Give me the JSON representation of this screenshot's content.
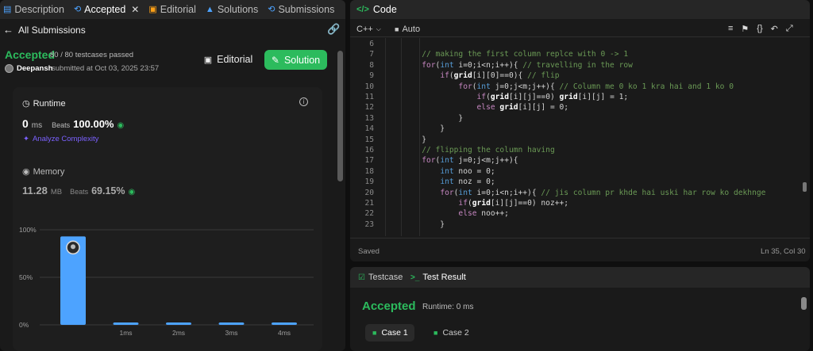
{
  "tabs": [
    {
      "label": "Description",
      "icon": "document-icon",
      "color": "#4da3ff"
    },
    {
      "label": "Accepted",
      "icon": "history-icon",
      "color": "#4da3ff"
    },
    {
      "label": "Editorial",
      "icon": "book-icon",
      "color": "#ffa116"
    },
    {
      "label": "Solutions",
      "icon": "flask-icon",
      "color": "#4da3ff"
    },
    {
      "label": "Submissions",
      "icon": "history-icon",
      "color": "#4da3ff"
    }
  ],
  "back_label": "All Submissions",
  "submission": {
    "status": "Accepted",
    "testcases": "80 / 80 testcases passed",
    "user": "Deepansh",
    "submitted": "submitted at Oct 03, 2025 23:57",
    "editorial_label": "Editorial",
    "solution_label": "Solution"
  },
  "runtime": {
    "title": "Runtime",
    "value": "0",
    "unit": "ms",
    "beats_label": "Beats",
    "beats_value": "100.00%",
    "analyze": "Analyze Complexity"
  },
  "memory": {
    "title": "Memory",
    "value": "11.28",
    "unit": "MB",
    "beats_label": "Beats",
    "beats_value": "69.15%"
  },
  "chart_data": {
    "type": "bar",
    "categories": [
      "",
      "1ms",
      "2ms",
      "3ms",
      "4ms"
    ],
    "values": [
      93,
      2,
      2,
      2,
      2
    ],
    "ylim": [
      0,
      100
    ],
    "ytick_labels": [
      "100%",
      "50%",
      "0%"
    ],
    "grid": true,
    "bar_color": "#4da3ff"
  },
  "editor": {
    "title": "Code",
    "language": "C++",
    "mode": "Auto",
    "status": "Saved",
    "cursor": "Ln 35, Col 30",
    "lines": [
      {
        "n": "6",
        "text": ""
      },
      {
        "n": "7",
        "text": "        // making the first column replce with 0 -> 1"
      },
      {
        "n": "8",
        "text": "        for(int i=0;i<n;i++){ // travelling in the row"
      },
      {
        "n": "9",
        "text": "            if(grid[i][0]==0){ // flip"
      },
      {
        "n": "10",
        "text": "                for(int j=0;j<m;j++){ // Column me 0 ko 1 kra hai and 1 ko 0"
      },
      {
        "n": "11",
        "text": "                    if(grid[i][j]==0) grid[i][j] = 1;"
      },
      {
        "n": "12",
        "text": "                    else grid[i][j] = 0;"
      },
      {
        "n": "13",
        "text": "                }"
      },
      {
        "n": "14",
        "text": "            }"
      },
      {
        "n": "15",
        "text": "        }"
      },
      {
        "n": "16",
        "text": "        // flipping the column having"
      },
      {
        "n": "17",
        "text": "        for(int j=0;j<m;j++){"
      },
      {
        "n": "18",
        "text": "            int noo = 0;"
      },
      {
        "n": "19",
        "text": "            int noz = 0;"
      },
      {
        "n": "20",
        "text": "            for(int i=0;i<n;i++){ // jis column pr khde hai uski har row ko dekhnge"
      },
      {
        "n": "21",
        "text": "                if(grid[i][j]==0) noz++;"
      },
      {
        "n": "22",
        "text": "                else noo++;"
      },
      {
        "n": "23",
        "text": "            }"
      }
    ]
  },
  "bottom": {
    "testcase_tab": "Testcase",
    "result_tab": "Test Result",
    "result": "Accepted",
    "runtime": "Runtime: 0 ms",
    "cases": [
      "Case 1",
      "Case 2"
    ]
  },
  "colors": {
    "accepted": "#2cbb5d",
    "keyword": "#c586c0",
    "comment": "#6a9955",
    "type": "#569cd6"
  }
}
